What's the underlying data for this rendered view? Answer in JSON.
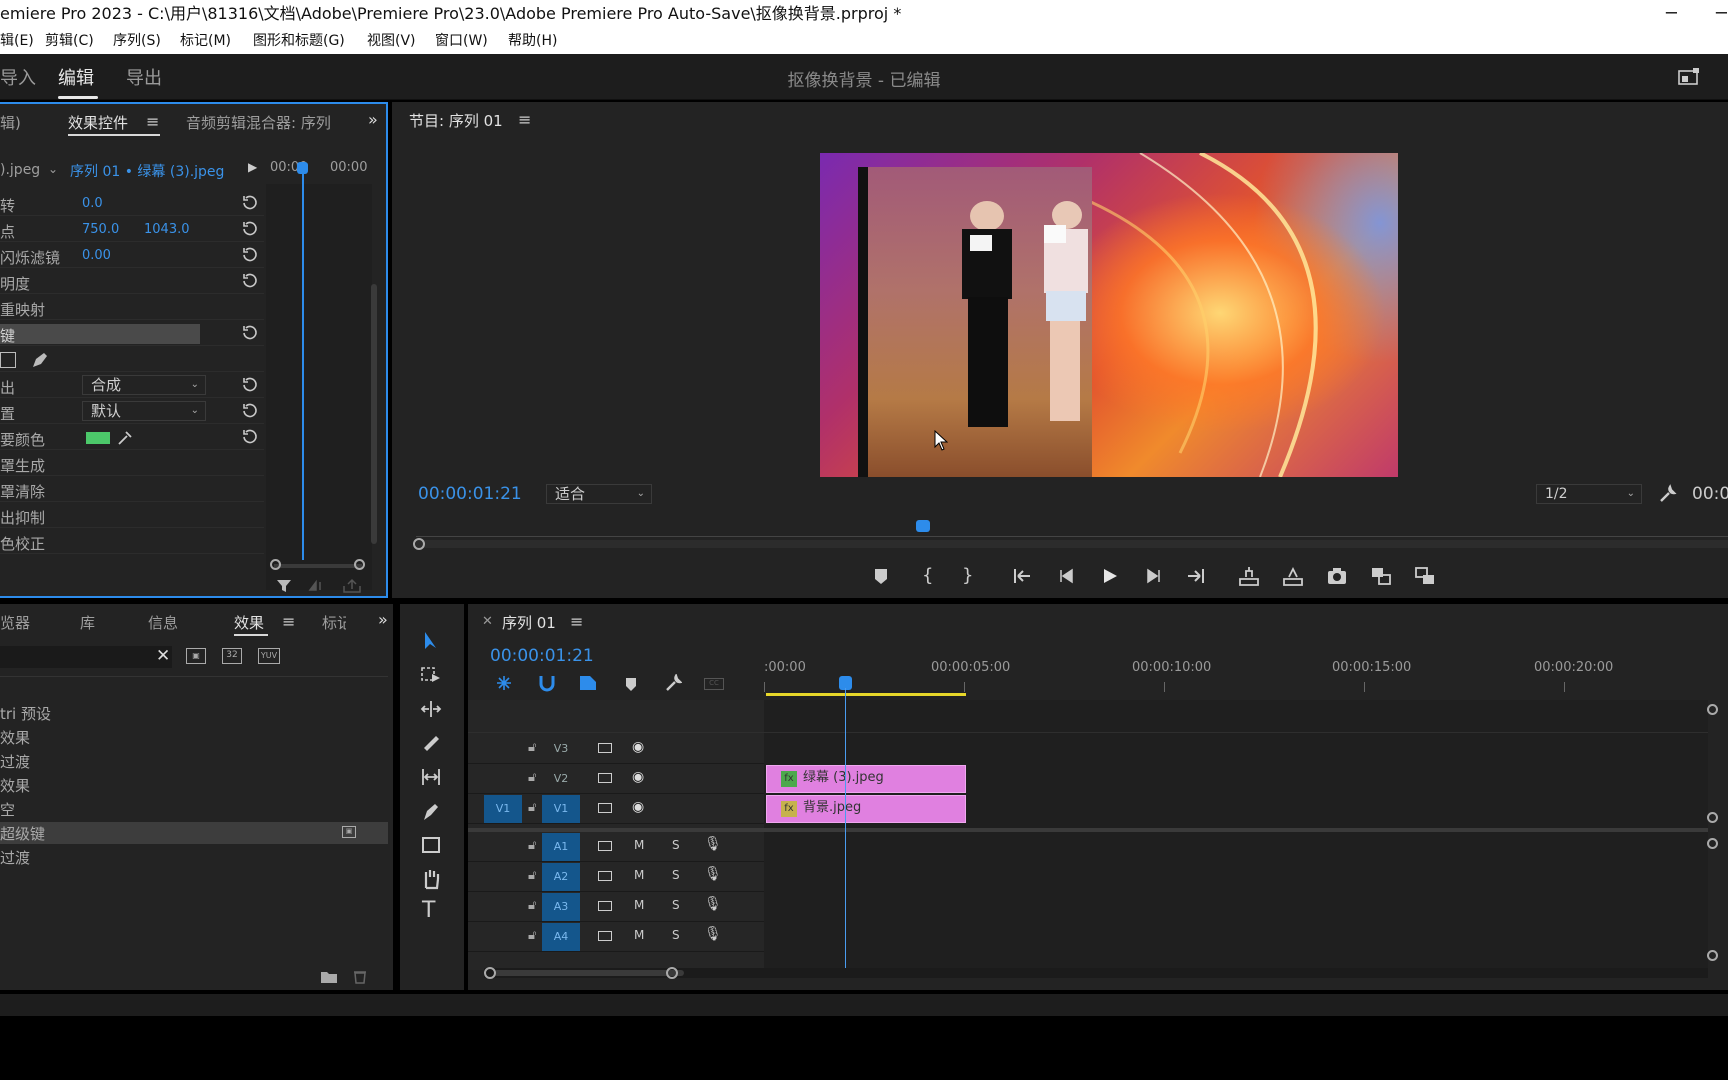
{
  "window": {
    "title": "emiere Pro 2023 - C:\\用户\\81316\\文档\\Adobe\\Premiere Pro\\23.0\\Adobe Premiere Pro Auto-Save\\抠像换背景.prproj *",
    "minimize": "─"
  },
  "menu": [
    "辑(E)",
    "剪辑(C)",
    "序列(S)",
    "标记(M)",
    "图形和标题(G)",
    "视图(V)",
    "窗口(W)",
    "帮助(H)"
  ],
  "workspace": {
    "tabs": [
      "导入",
      "编辑",
      "导出"
    ],
    "active": "编辑",
    "project_title": "抠像换背景",
    "project_status": "- 已编辑"
  },
  "effect_controls": {
    "tab_prev": "辑)",
    "tab_active": "效果控件",
    "tab_next": "音频剪辑混合器: 序列",
    "clip_master": ").jpeg",
    "clip_sequence": "序列 01 • 绿幕 (3).jpeg",
    "mini_time_a": "00:00",
    "mini_time_b": "00:00",
    "rows": [
      {
        "label": "转",
        "v1": "0.0",
        "v2": ""
      },
      {
        "label": "点",
        "v1": "750.0",
        "v2": "1043.0"
      },
      {
        "label": "闪烁滤镜",
        "v1": "0.00",
        "v2": ""
      },
      {
        "label": "明度",
        "v1": "",
        "v2": ""
      },
      {
        "label": "重映射",
        "v1": "",
        "v2": ""
      },
      {
        "label": "键",
        "v1": "",
        "v2": ""
      }
    ],
    "output_label": "出",
    "output_value": "合成",
    "setting_label": "置",
    "setting_value": "默认",
    "key_color_label": "要颜色",
    "key_color": "#4cc86a",
    "sub_rows": [
      "罩生成",
      "罩清除",
      "出抑制",
      "色校正"
    ]
  },
  "program_monitor": {
    "tab": "节目: 序列 01",
    "timecode": "00:00:01:21",
    "fit": "适合",
    "resolution": "1/2",
    "duration_partial": "00:0"
  },
  "effects_panel": {
    "tabs": [
      "览器",
      "库",
      "信息",
      "效果",
      "标记"
    ],
    "active": "效果",
    "items": [
      "tri 预设",
      "效果",
      "过渡",
      "效果",
      "空",
      "超级键",
      "过渡"
    ],
    "selected_index": 5
  },
  "timeline": {
    "tab": "序列 01",
    "timecode": "00:00:01:21",
    "ruler": [
      ":00:00",
      "00:00:05:00",
      "00:00:10:00",
      "00:00:15:00",
      "00:00:20:00"
    ],
    "video_tracks": [
      "V3",
      "V2",
      "V1"
    ],
    "audio_tracks": [
      "A1",
      "A2",
      "A3",
      "A4"
    ],
    "source_patch": "V1",
    "track_m": "M",
    "track_s": "S",
    "clips": [
      {
        "track": "V2",
        "name": "绿幕 (3).jpeg"
      },
      {
        "track": "V1",
        "name": "背景.jpeg"
      }
    ],
    "fx_label": "fx"
  },
  "colors": {
    "accent": "#2d8ceb",
    "clip": "#e080e0",
    "timecode": "#3a92e8"
  }
}
